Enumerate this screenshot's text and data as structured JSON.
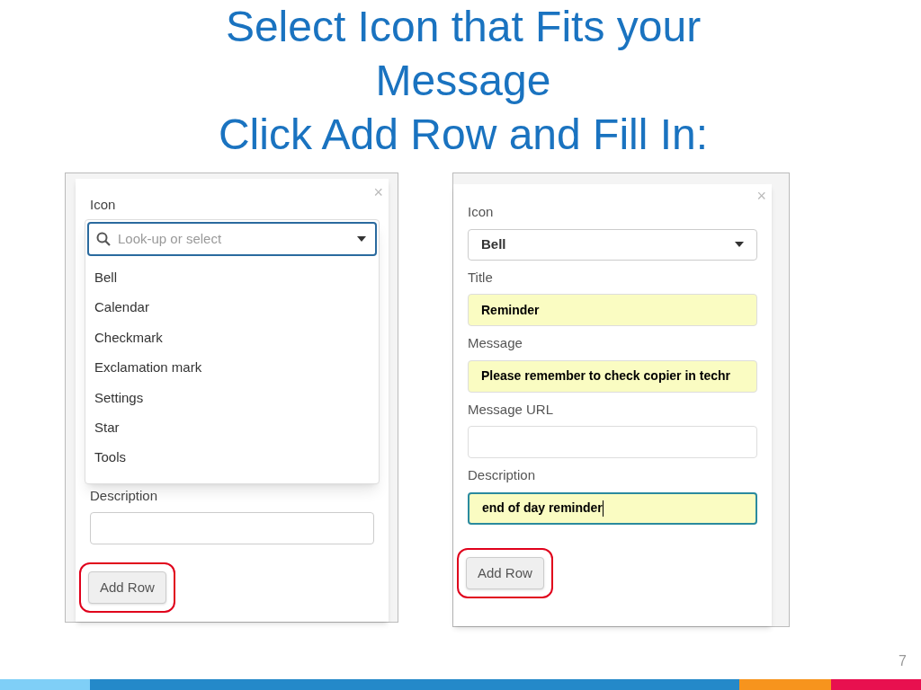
{
  "slide": {
    "title_lines": [
      "Select Icon that Fits your",
      "Message",
      "Click Add Row and Fill In:"
    ],
    "page_number": "7"
  },
  "left_form": {
    "close": "×",
    "icon_label": "Icon",
    "search": {
      "placeholder": "Look-up or select",
      "focused": true
    },
    "options": [
      {
        "label": "Bell",
        "selected": false
      },
      {
        "label": "Calendar",
        "selected": false
      },
      {
        "label": "Checkmark",
        "selected": false
      },
      {
        "label": "Exclamation mark",
        "selected": false
      },
      {
        "label": "Settings",
        "selected": false
      },
      {
        "label": "Star",
        "selected": false
      },
      {
        "label": "Tools",
        "selected": false
      }
    ],
    "description_label": "Description",
    "button": {
      "label": "Add Row",
      "highlighted": true
    }
  },
  "right_form": {
    "close": "×",
    "fields": [
      {
        "kind": "select",
        "label": "Icon",
        "value": "Bell"
      },
      {
        "kind": "text",
        "label": "Title",
        "value": "Reminder",
        "filled": true,
        "focused": false
      },
      {
        "kind": "text",
        "label": "Message",
        "value": "Please remember to check copier in techr",
        "filled": true,
        "focused": false
      },
      {
        "kind": "text",
        "label": "Message URL",
        "filled": false,
        "focused": false
      },
      {
        "kind": "text",
        "label": "Description",
        "value": "end of day reminder",
        "filled": true,
        "focused": true
      }
    ],
    "button": {
      "label": "Add Row",
      "highlighted": true
    }
  }
}
